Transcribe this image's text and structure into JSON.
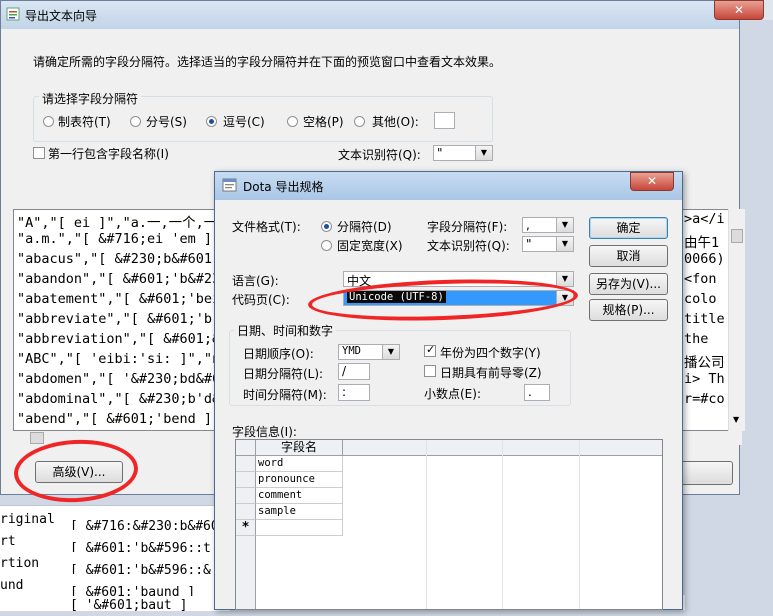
{
  "background": {
    "rows": [
      {
        "col1": "riginal",
        "col2": "[ &#716;&#230;b&#60"
      },
      {
        "col1": "rt",
        "col2": "[ &#601;'b&#596;:t"
      },
      {
        "col1": "rtion",
        "col2": "[ &#601;'b&#596;:&"
      },
      {
        "col1": "und",
        "col2": "[ &#601;'baund ]"
      },
      {
        "col1": "",
        "col2": "[ '&#601;baut ]"
      }
    ]
  },
  "wizard": {
    "title": "导出文本向导",
    "close_glyph": "✕",
    "instruction": "请确定所需的字段分隔符。选择适当的字段分隔符并在下面的预览窗口中查看文本效果。",
    "delimiter_group_label": "请选择字段分隔符",
    "delimiters": [
      {
        "label": "制表符(T)",
        "selected": false
      },
      {
        "label": "分号(S)",
        "selected": false
      },
      {
        "label": "逗号(C)",
        "selected": true
      },
      {
        "label": "空格(P)",
        "selected": false
      },
      {
        "label": "其他(O):",
        "selected": false
      }
    ],
    "first_row_label": "第一行包含字段名称(I)",
    "qualifier_label": "文本识别符(Q):",
    "qualifier_value": "\"",
    "preview_lines": [
      "\"A\",\"[ ei ]\",\"a.一,一个,一",
      "\"a.m.\",\"[ &#716;ei 'em ]\"",
      "\"abacus\",\"[ &#230;b&#601",
      "\"abandon\",\"[ &#601;'b&#23",
      "\"abatement\",\"[ &#601;'bei",
      "\"abbreviate\",\"[ &#601;'br",
      "\"abbreviation\",\"[ &#601;&",
      "\"ABC\",\"[ 'eibi:'si: ]\",\"n",
      "\"abdomen\",\"[ '&#230;bd&#6",
      "\"abdominal\",\"[ &#230;b'd&",
      "\"abend\",\"[ &#601;'bend ]\""
    ],
    "preview_right": [
      ">a</i",
      "由午1",
      "0066)",
      "<fon",
      "colo",
      "title",
      "the",
      "播公司",
      "i> Th",
      "r=#co"
    ],
    "advanced_button": "高级(V)..."
  },
  "dialog": {
    "title": "Dota 导出规格",
    "close_glyph": "✕",
    "file_format_label": "文件格式(T):",
    "format_delimited": "分隔符(D)",
    "format_fixed": "固定宽度(X)",
    "field_delimiter_label": "字段分隔符(F):",
    "field_delimiter_value": ",",
    "text_qualifier_label": "文本识别符(Q):",
    "text_qualifier_value": "\"",
    "language_label": "语言(G):",
    "language_value": "中文",
    "code_page_label": "代码页(C):",
    "code_page_value": "Unicode (UTF-8)",
    "date_group_label": "日期、时间和数字",
    "date_order_label": "日期顺序(O):",
    "date_order_value": "YMD",
    "four_digit_year_label": "年份为四个数字(Y)",
    "date_separator_label": "日期分隔符(L):",
    "date_separator_value": "/",
    "leading_zero_label": "日期具有前导零(Z)",
    "time_separator_label": "时间分隔符(M):",
    "time_separator_value": ":",
    "decimal_label": "小数点(E):",
    "decimal_value": ".",
    "buttons": {
      "ok": "确定",
      "cancel": "取消",
      "save_as": "另存为(V)...",
      "specs": "规格(P)..."
    },
    "field_info_label": "字段信息(I):",
    "grid_header": "字段名",
    "fields": [
      "word",
      "pronounce",
      "comment",
      "sample"
    ],
    "new_row_glyph": "*"
  },
  "colors": {
    "annotation": "#f02626"
  }
}
